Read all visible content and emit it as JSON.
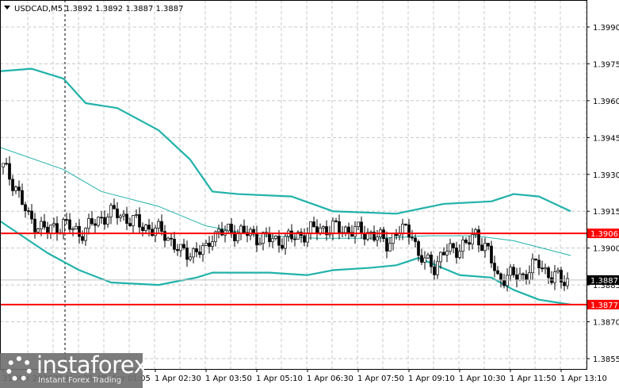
{
  "header": {
    "symbol": "USDCAD,M5",
    "ohlc": "1.3892 1.3892 1.3887 1.3887"
  },
  "logo": {
    "brand": "instaforex",
    "tagline": "Instant Forex Trading"
  },
  "chart_data": {
    "type": "candlestick",
    "title": "USDCAD,M5",
    "bar_minutes": 5,
    "ylim": [
      1.3848,
      1.4001
    ],
    "y_ticks": [
      "1.3990",
      "1.3975",
      "1.3960",
      "1.3945",
      "1.3930",
      "1.3915",
      "1.3900",
      "1.3885",
      "1.3870",
      "1.3855"
    ],
    "x_ticks": [
      {
        "bar": 0,
        "label": "31 Mar 2026"
      },
      {
        "bar": 16,
        "label": "31 Mar 23:45"
      },
      {
        "bar": 32,
        "label": "1 Apr 01:05"
      },
      {
        "bar": 48,
        "label": "1 Apr 02:30"
      },
      {
        "bar": 64,
        "label": "1 Apr 03:50"
      },
      {
        "bar": 80,
        "label": "1 Apr 05:10"
      },
      {
        "bar": 96,
        "label": "1 Apr 06:30"
      },
      {
        "bar": 112,
        "label": "1 Apr 07:50"
      },
      {
        "bar": 128,
        "label": "1 Apr 09:10"
      },
      {
        "bar": 144,
        "label": "1 Apr 10:30"
      },
      {
        "bar": 160,
        "label": "1 Apr 11:50"
      },
      {
        "bar": 176,
        "label": "1 Apr 13:10"
      }
    ],
    "price_path": [
      [
        0,
        1.3933
      ],
      [
        4,
        1.3925
      ],
      [
        8,
        1.3912
      ],
      [
        14,
        1.3907
      ],
      [
        19,
        1.391
      ],
      [
        24,
        1.3906
      ],
      [
        33,
        1.3914
      ],
      [
        36,
        1.3914
      ],
      [
        44,
        1.3909
      ],
      [
        51,
        1.3906
      ],
      [
        56,
        1.3898
      ],
      [
        64,
        1.3899
      ],
      [
        66,
        1.3906
      ],
      [
        74,
        1.3907
      ],
      [
        79,
        1.3905
      ],
      [
        86,
        1.3903
      ],
      [
        91,
        1.3904
      ],
      [
        99,
        1.3908
      ],
      [
        106,
        1.3908
      ],
      [
        116,
        1.3906
      ],
      [
        121,
        1.3902
      ],
      [
        125,
        1.3907
      ],
      [
        129,
        1.3907
      ],
      [
        131,
        1.3896
      ],
      [
        136,
        1.3893
      ],
      [
        140,
        1.3899
      ],
      [
        146,
        1.3901
      ],
      [
        149,
        1.3906
      ],
      [
        153,
        1.3898
      ],
      [
        156,
        1.3888
      ],
      [
        164,
        1.3889
      ],
      [
        169,
        1.3894
      ],
      [
        173,
        1.3888
      ],
      [
        178,
        1.3887
      ]
    ],
    "bands": {
      "upper": [
        [
          -1,
          1.3972
        ],
        [
          9,
          1.3973
        ],
        [
          19,
          1.3969
        ],
        [
          26,
          1.3959
        ],
        [
          36,
          1.3957
        ],
        [
          49,
          1.3948
        ],
        [
          59,
          1.3936
        ],
        [
          66,
          1.3923
        ],
        [
          74,
          1.3922
        ],
        [
          91,
          1.3921
        ],
        [
          104,
          1.3915
        ],
        [
          124,
          1.3914
        ],
        [
          139,
          1.3918
        ],
        [
          154,
          1.3919
        ],
        [
          161,
          1.3922
        ],
        [
          169,
          1.3921
        ],
        [
          179,
          1.3915
        ]
      ],
      "middle": [
        [
          -1,
          1.3941
        ],
        [
          19,
          1.3932
        ],
        [
          31,
          1.3923
        ],
        [
          49,
          1.3917
        ],
        [
          64,
          1.3909
        ],
        [
          81,
          1.3905
        ],
        [
          99,
          1.3904
        ],
        [
          119,
          1.3904
        ],
        [
          134,
          1.3905
        ],
        [
          149,
          1.3905
        ],
        [
          161,
          1.3903
        ],
        [
          179,
          1.3897
        ]
      ],
      "lower": [
        [
          -1,
          1.3911
        ],
        [
          14,
          1.3898
        ],
        [
          24,
          1.3891
        ],
        [
          34,
          1.3886
        ],
        [
          49,
          1.3885
        ],
        [
          61,
          1.3888
        ],
        [
          66,
          1.389
        ],
        [
          84,
          1.389
        ],
        [
          96,
          1.3889
        ],
        [
          104,
          1.3891
        ],
        [
          116,
          1.3892
        ],
        [
          124,
          1.3893
        ],
        [
          131,
          1.3896
        ],
        [
          144,
          1.3889
        ],
        [
          154,
          1.3888
        ],
        [
          161,
          1.3883
        ],
        [
          169,
          1.3879
        ],
        [
          179,
          1.3877
        ]
      ]
    },
    "levels": [
      {
        "price": "1.3906",
        "color": "#ff0000"
      },
      {
        "price": "1.3877",
        "color": "#ff0000"
      }
    ],
    "current_price": "1.3887",
    "colors": {
      "band": "#20b2aa",
      "level": "#ff0000"
    }
  }
}
